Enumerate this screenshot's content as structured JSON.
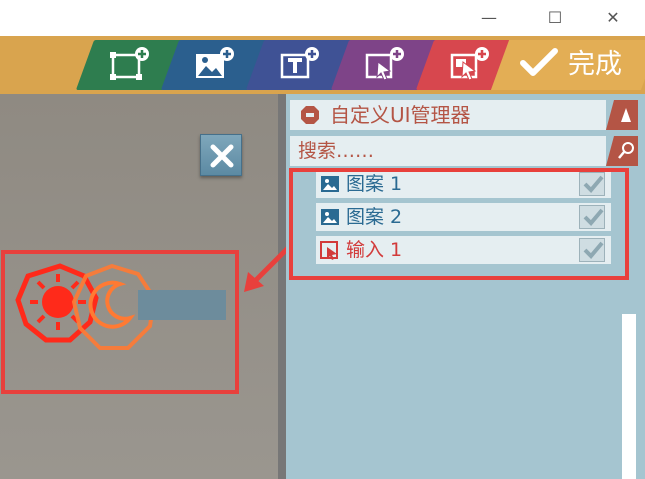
{
  "window": {
    "minimize_glyph": "—",
    "maximize_glyph": "☐",
    "close_glyph": "✕"
  },
  "toolbar": {
    "tools": [
      {
        "id": "add-rect",
        "icon": "add-rectangle-icon",
        "color": "#2e7d4f"
      },
      {
        "id": "add-image",
        "icon": "add-image-icon",
        "color": "#2b5f8e"
      },
      {
        "id": "add-text",
        "icon": "add-text-icon",
        "color": "#3f5295"
      },
      {
        "id": "add-button",
        "icon": "add-button-icon",
        "color": "#7e4488"
      },
      {
        "id": "add-input",
        "icon": "add-input-icon",
        "color": "#d7474e"
      }
    ],
    "done_label": "完成"
  },
  "panel": {
    "title": "自定义UI管理器",
    "search_placeholder": "搜索……",
    "items": [
      {
        "label": "图案 1",
        "type": "image",
        "color": "#2a6a92",
        "checked": true
      },
      {
        "label": "图案 2",
        "type": "image",
        "color": "#2a6a92",
        "checked": true
      },
      {
        "label": "输入 1",
        "type": "input",
        "color": "#d23a3a",
        "checked": true
      }
    ]
  },
  "colors": {
    "accent_red": "#e8403c",
    "toolbar_bg": "#d9a44e",
    "panel_bg": "#a5c5d0"
  }
}
